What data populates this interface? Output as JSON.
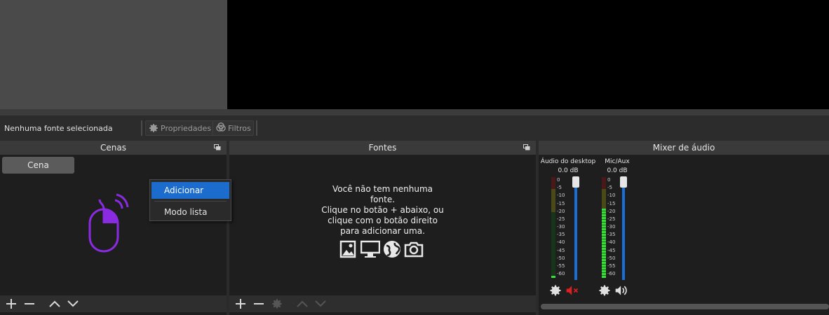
{
  "toolbar": {
    "no_source": "Nenhuma fonte selecionada",
    "properties_label": "Propriedades",
    "filters_label": "Filtros"
  },
  "scenes": {
    "title": "Cenas",
    "items": [
      "Cena"
    ]
  },
  "context_menu": {
    "items": [
      {
        "label": "Adicionar",
        "active": true
      },
      {
        "label": "Modo lista",
        "active": false
      }
    ]
  },
  "sources": {
    "title": "Fontes",
    "empty_lines": [
      "Você não tem nenhuma",
      "fonte.",
      "Clique no botão + abaixo, ou",
      "clique com o botão direito",
      "para adicionar uma."
    ]
  },
  "mixer": {
    "title": "Mixer de áudio",
    "ticks": [
      "0",
      "-5",
      "-10",
      "-15",
      "-20",
      "-25",
      "-30",
      "-35",
      "-40",
      "-45",
      "-50",
      "-55",
      "-60"
    ],
    "channels": [
      {
        "name": "Áudio do desktop",
        "db": "0.0 dB",
        "muted": true,
        "level": 0.02
      },
      {
        "name": "Mic/Aux",
        "db": "0.0 dB",
        "muted": false,
        "level": 0.69
      }
    ]
  },
  "colors": {
    "accent": "#1b6ccc",
    "mouse_icon": "#8a2be2",
    "muted": "#e02020"
  }
}
